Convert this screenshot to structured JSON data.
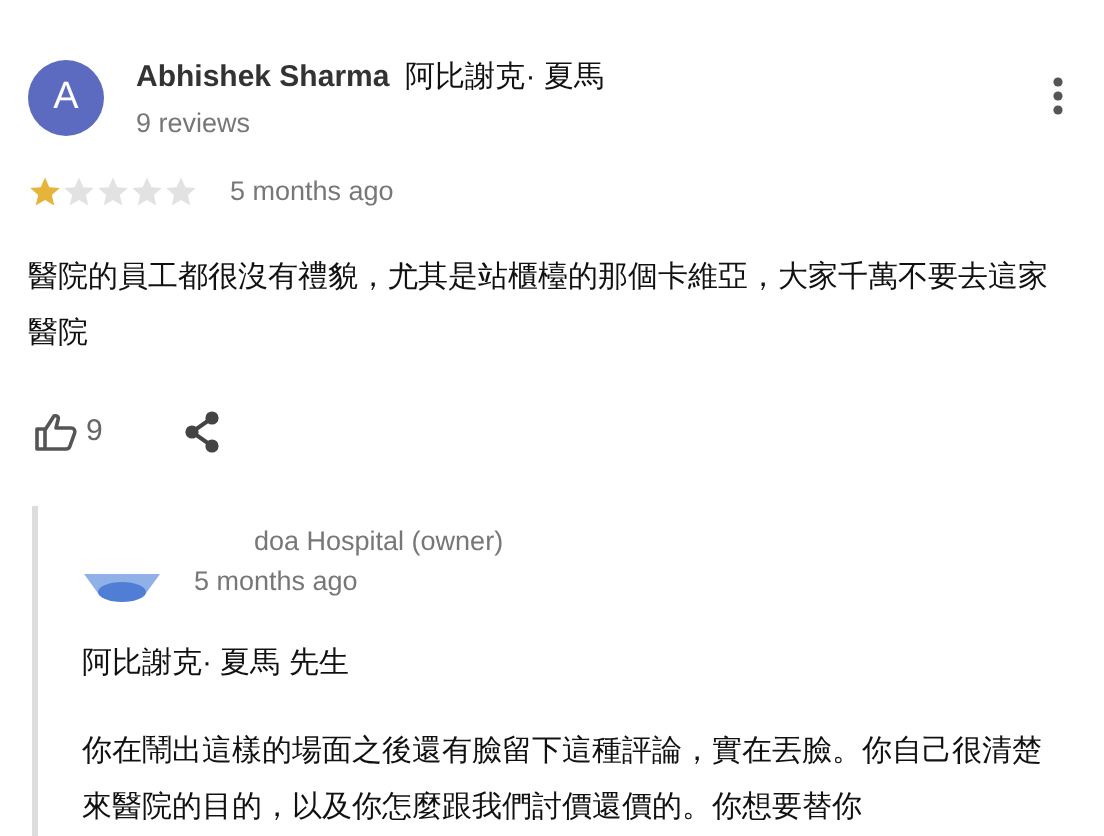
{
  "review": {
    "avatar_letter": "A",
    "author": "Abhishek Sharma",
    "author_alt": "阿比謝克· 夏馬",
    "review_count": "9 reviews",
    "stars": 1,
    "time": "5 months ago",
    "text": "醫院的員工都很沒有禮貌，尤其是站櫃檯的那個卡維亞，大家千萬不要去這家醫院",
    "likes": "9"
  },
  "reply": {
    "owner": "doa Hospital (owner)",
    "time": "5 months ago",
    "greeting": "阿比謝克· 夏馬 先生",
    "text": "你在鬧出這樣的場面之後還有臉留下這種評論，實在丟臉。你自己很清楚來醫院的目的，以及你怎麼跟我們討價還價的。你想要替你"
  }
}
